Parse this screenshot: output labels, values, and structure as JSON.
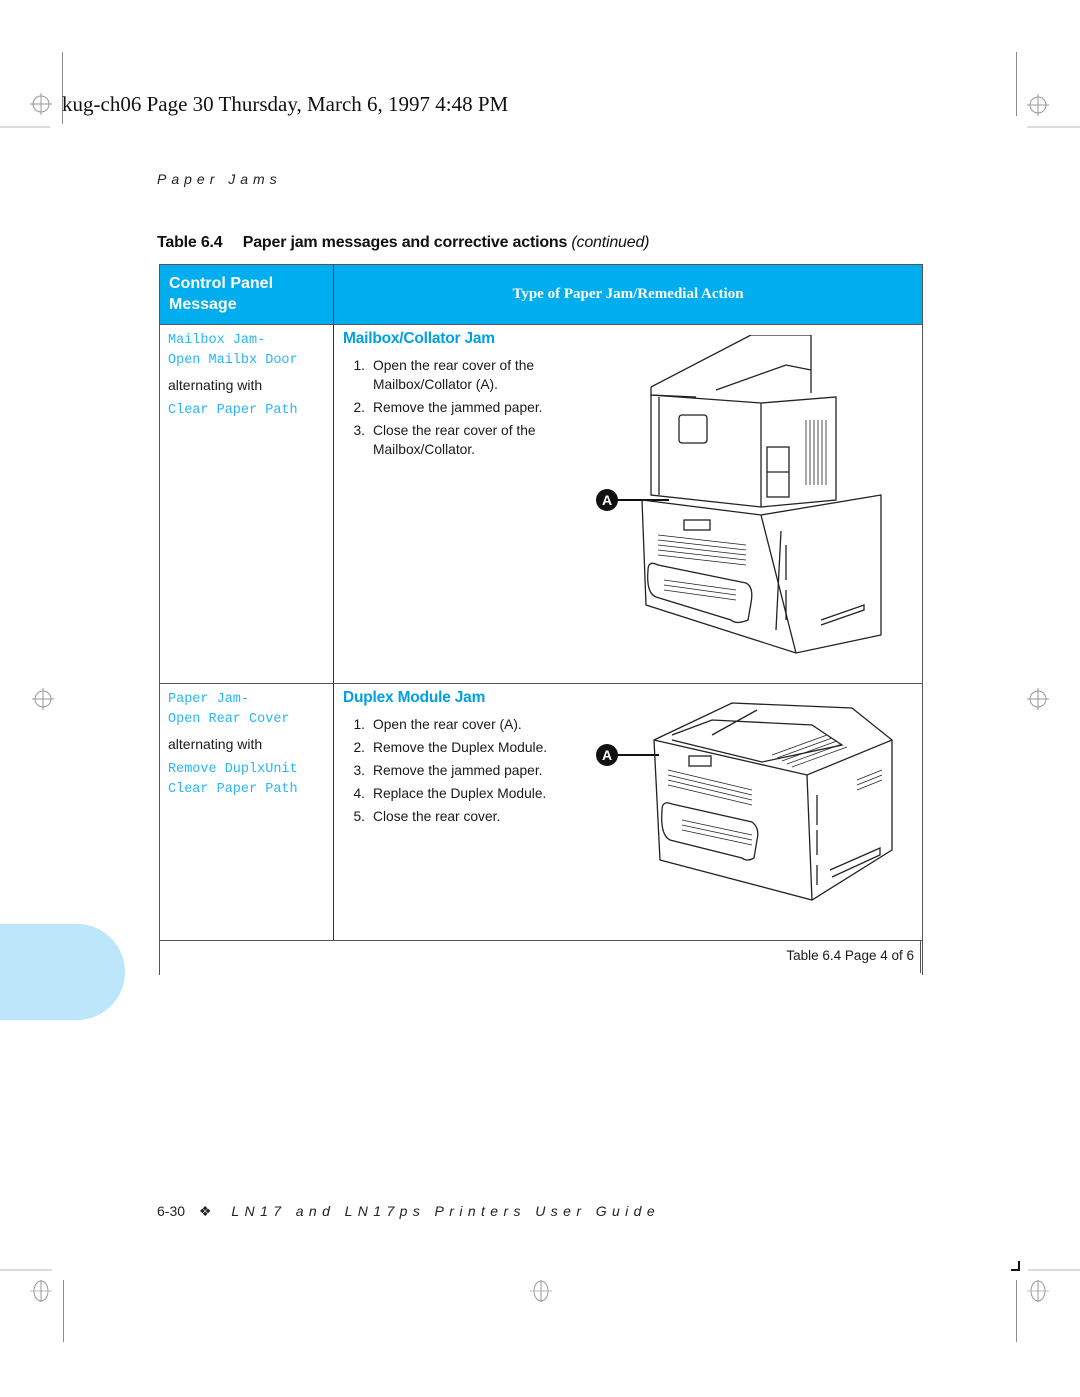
{
  "slug": "kug-ch06  Page 30  Thursday, March 6, 1997  4:48 PM",
  "running_head": "Paper Jams",
  "table": {
    "number": "Table 6.4",
    "title": "Paper jam messages and corrective actions",
    "continued": "(continued)",
    "header": {
      "col1_line1": "Control Panel",
      "col1_line2": "Message",
      "col2": "Type of Paper Jam/Remedial Action"
    },
    "rows": [
      {
        "messages_a": [
          "Mailbox Jam-",
          "Open Mailbx Door"
        ],
        "alternating": "alternating with",
        "messages_b": [
          "Clear Paper Path"
        ],
        "section_title": "Mailbox/Collator Jam",
        "steps": [
          "Open the rear cover of the Mailbox/Collator (A).",
          "Remove the jammed paper.",
          "Close the rear cover of the Mailbox/Collator."
        ],
        "callout": "A",
        "illustration": "printer-with-mailbox-collator-rear-view"
      },
      {
        "messages_a": [
          "Paper Jam-",
          "Open Rear Cover"
        ],
        "alternating": "alternating with",
        "messages_b": [
          "Remove DuplxUnit",
          "Clear Paper Path"
        ],
        "section_title": "Duplex Module Jam",
        "steps": [
          "Open the rear cover (A).",
          "Remove the Duplex Module.",
          "Remove the jammed paper.",
          "Replace the Duplex Module.",
          "Close the rear cover."
        ],
        "callout": "A",
        "illustration": "printer-duplex-module-rear-view"
      }
    ],
    "page_indicator": "Table 6.4  Page 4 of 6"
  },
  "footer": {
    "page_number": "6-30",
    "separator_icon": "diamond-ornament-icon",
    "separator": "❖",
    "guide_title": "LN17 and LN17ps Printers User Guide"
  },
  "colors": {
    "header_bg": "#00aeef",
    "accent_text": "#00a0e3",
    "lcd_text": "#29b6f6",
    "thumb_tab": "#bde6fa"
  }
}
